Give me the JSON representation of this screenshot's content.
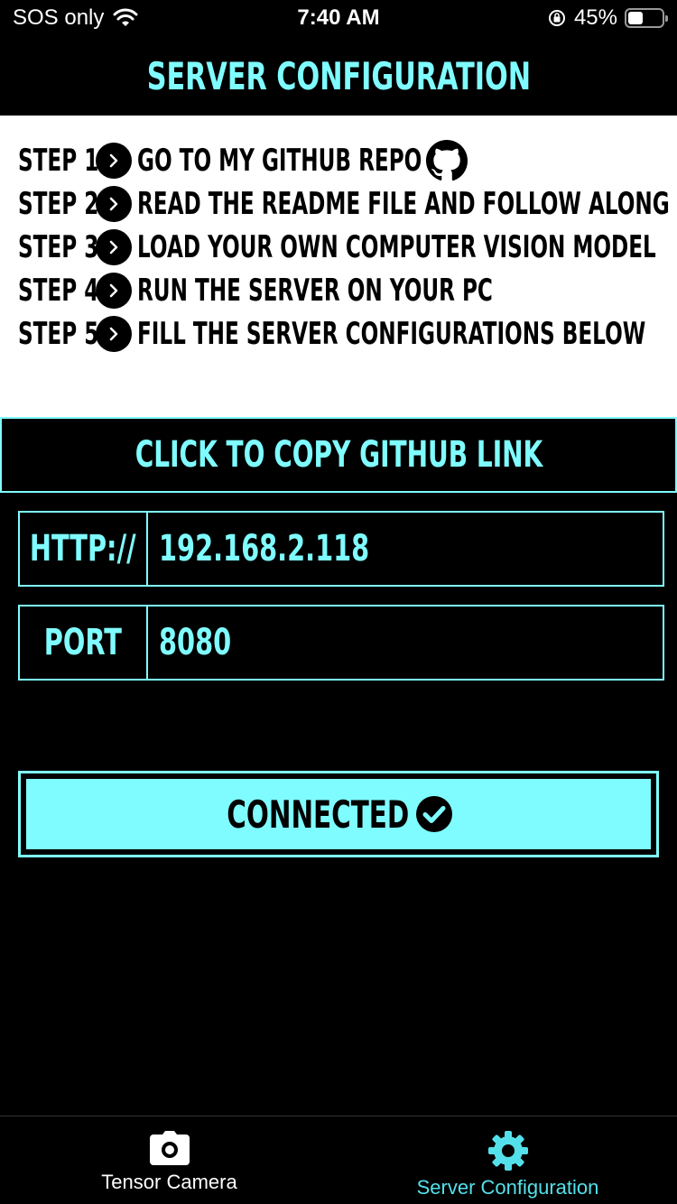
{
  "status_bar": {
    "carrier": "SOS only",
    "time": "7:40 AM",
    "battery_percent": "45%",
    "battery_level": 0.45
  },
  "header": {
    "title": "SERVER CONFIGURATION"
  },
  "steps": [
    {
      "number": "STEP 1",
      "text": "GO TO MY GITHUB REPO"
    },
    {
      "number": "STEP 2",
      "text": "READ THE README FILE AND FOLLOW ALONG"
    },
    {
      "number": "STEP 3",
      "text": "LOAD YOUR OWN COMPUTER VISION MODEL"
    },
    {
      "number": "STEP 4",
      "text": "RUN THE SERVER ON YOUR PC"
    },
    {
      "number": "STEP 5",
      "text": "FILL THE SERVER CONFIGURATIONS BELOW"
    }
  ],
  "copy_button": {
    "label": "CLICK TO COPY GITHUB LINK"
  },
  "host_field": {
    "prefix": "HTTP://",
    "value": "192.168.2.118"
  },
  "port_field": {
    "prefix": "PORT",
    "value": "8080"
  },
  "connect_button": {
    "label": "CONNECTED"
  },
  "tab_bar": {
    "tabs": [
      {
        "label": "Tensor Camera",
        "icon": "camera-icon",
        "active": false
      },
      {
        "label": "Server Configuration",
        "icon": "gear-icon",
        "active": true
      }
    ]
  },
  "colors": {
    "accent": "#7ffcff",
    "background": "#000000",
    "panel": "#ffffff"
  }
}
